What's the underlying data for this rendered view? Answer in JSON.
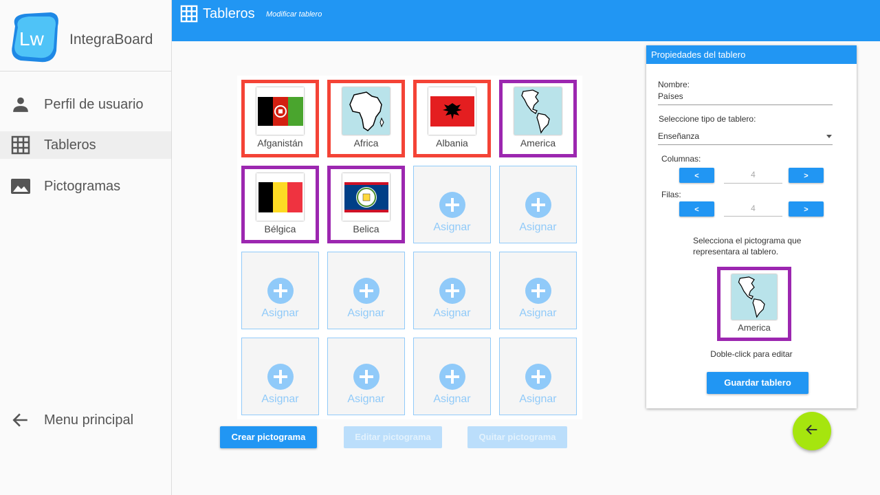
{
  "app": {
    "logo_text": "Lw",
    "name": "IntegraBoard"
  },
  "sidebar": {
    "items": [
      {
        "label": "Perfil de usuario",
        "icon": "person-icon"
      },
      {
        "label": "Tableros",
        "icon": "grid-icon"
      },
      {
        "label": "Pictogramas",
        "icon": "image-icon"
      }
    ],
    "back_label": "Menu principal"
  },
  "header": {
    "title": "Tableros",
    "subtitle": "Modificar tablero"
  },
  "board": {
    "columns": 4,
    "rows": 4,
    "cells": [
      {
        "type": "pictogram",
        "label": "Afganistán",
        "border": "#f44336",
        "image": "afghanistan-flag"
      },
      {
        "type": "pictogram",
        "label": "Africa",
        "border": "#f44336",
        "image": "africa-map"
      },
      {
        "type": "pictogram",
        "label": "Albania",
        "border": "#f44336",
        "image": "albania-flag"
      },
      {
        "type": "pictogram",
        "label": "America",
        "border": "#9c27b0",
        "image": "america-map"
      },
      {
        "type": "pictogram",
        "label": "Bélgica",
        "border": "#9c27b0",
        "image": "belgium-flag"
      },
      {
        "type": "pictogram",
        "label": "Belica",
        "border": "#9c27b0",
        "image": "belize-flag"
      }
    ],
    "empty_label": "Asignar"
  },
  "actions": {
    "create": "Crear pictograma",
    "edit": "Editar pictograma",
    "remove": "Quitar pictograma"
  },
  "properties": {
    "title": "Propiedades del tablero",
    "name_label": "Nombre:",
    "name_value": "Países",
    "type_label": "Seleccione tipo de tablero:",
    "type_value": "Enseñanza",
    "columns_label": "Columnas:",
    "columns_value": "4",
    "rows_label": "Filas:",
    "rows_value": "4",
    "dec_label": "<",
    "inc_label": ">",
    "select_text": "Selecciona el pictograma que representara al tablero.",
    "representative": {
      "label": "America",
      "image": "america-map"
    },
    "double_click_hint": "Doble-click para editar",
    "save_label": "Guardar tablero"
  },
  "colors": {
    "primary": "#2196f3",
    "red_border": "#f44336",
    "purple_border": "#9c27b0",
    "fab": "#a6e50e",
    "light_blue": "#90caf9"
  },
  "fab_icon": "arrow-left-icon"
}
